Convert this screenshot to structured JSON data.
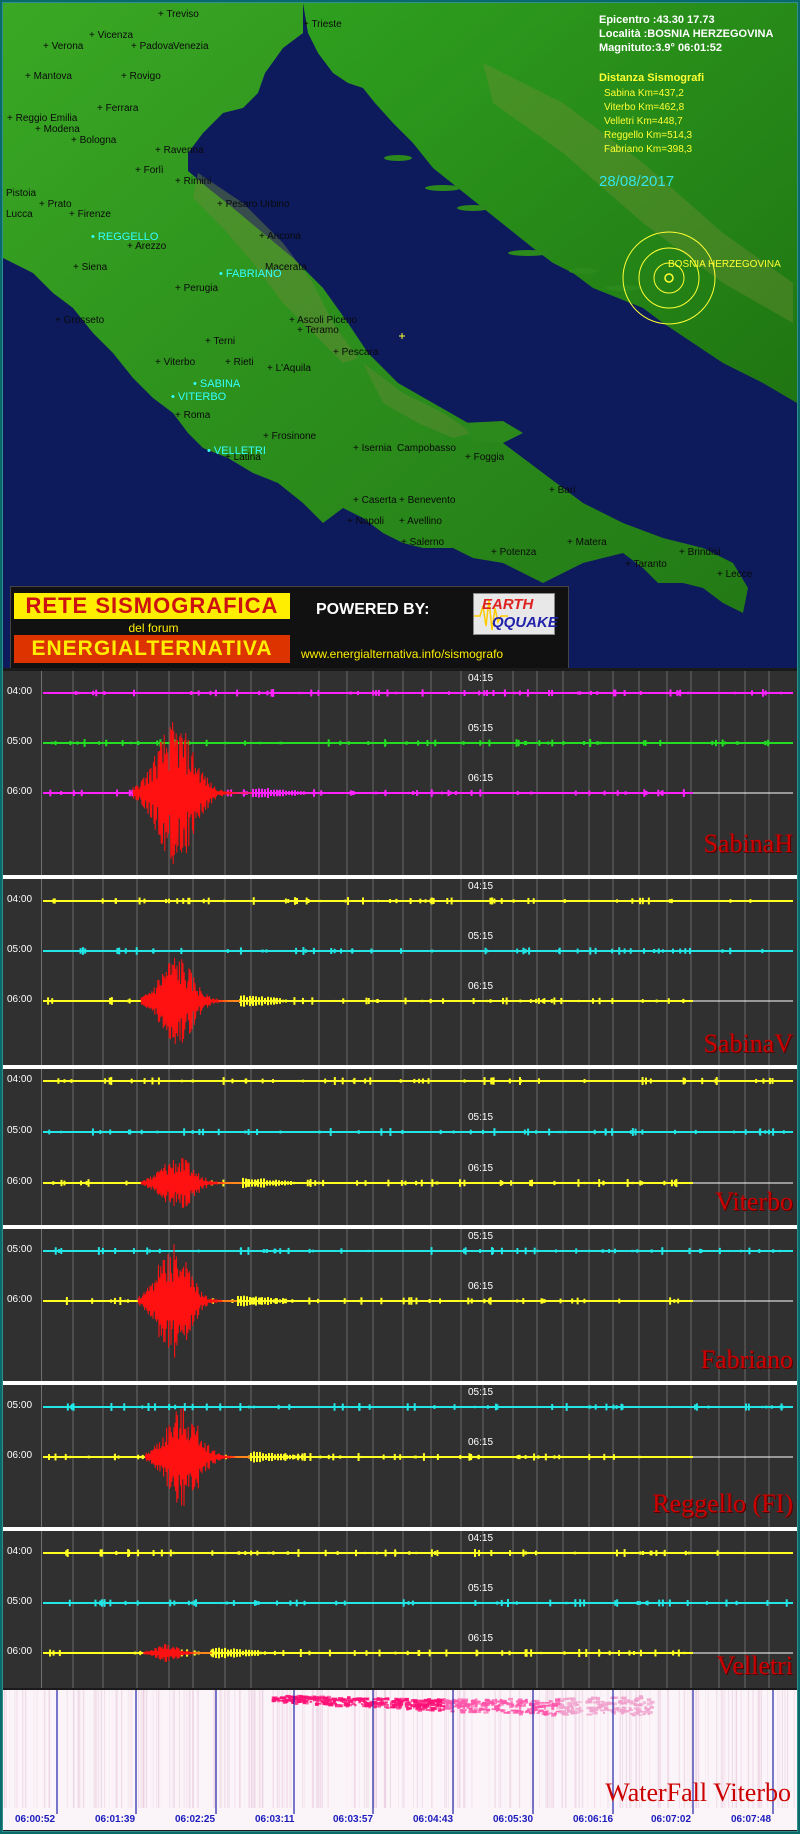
{
  "map": {
    "info": {
      "epicentro": "Epicentro :43.30 17.73",
      "localita": "Località :BOSNIA HERZEGOVINA",
      "magnitudo": "Magnituto:3.9°  06:01:52",
      "distanza_title": "Distanza Sismografi",
      "distances": [
        "Sabina Km=437,2",
        "Viterbo Km=462,8",
        "Velletri Km=448,7",
        "Reggello Km=514,3",
        "Fabriano Km=398,3"
      ],
      "date": "28/08/2017"
    },
    "epicenter_label": "BOSNIA HERZEGOVINA",
    "cities": [
      "Treviso",
      "Trieste",
      "Vicenza",
      "Verona",
      "Padova",
      "Venezia",
      "Mantova",
      "Rovigo",
      "Ferrara",
      "Reggio Emilia",
      "Modena",
      "Bologna",
      "Ravenna",
      "Forlì",
      "Rimini",
      "Pistoia",
      "Prato",
      "Firenze",
      "Lucca",
      "Pesaro Urbino",
      "Ancona",
      "Arezzo",
      "Siena",
      "Macerata",
      "Perugia",
      "Grosseto",
      "Ascoli Piceno",
      "Teramo",
      "Terni",
      "Pescara",
      "Viterbo",
      "Rieti",
      "L'Aquila",
      "Roma",
      "Frosinone",
      "Latina",
      "Isernia",
      "Campobasso",
      "Foggia",
      "Bari",
      "Caserta",
      "Benevento",
      "Napoli",
      "Avellino",
      "Salerno",
      "Potenza",
      "Matera",
      "Taranto",
      "Brindisi",
      "Lecce"
    ],
    "stations": [
      "REGGELLO",
      "FABRIANO",
      "SABINA",
      "VITERBO",
      "VELLETRI"
    ]
  },
  "banner": {
    "rete": "RETE SISMOGRAFICA",
    "forum": "del forum",
    "energia": "ENERGIALTERNATIVA",
    "powered": "POWERED BY:",
    "logo_earth": "EARTH",
    "logo_quake": "QQUAKE",
    "url": "www.energialternativa.info/sismografo"
  },
  "panels": [
    {
      "name": "SabinaH",
      "hours": [
        "04:00",
        "05:00",
        "06:00"
      ],
      "center": [
        "04:15",
        "05:15",
        "06:15"
      ]
    },
    {
      "name": "SabinaV",
      "hours": [
        "04:00",
        "05:00",
        "06:00"
      ],
      "center": [
        "04:15",
        "05:15",
        "06:15"
      ]
    },
    {
      "name": "Viterbo",
      "hours": [
        "04:00",
        "05:00",
        "06:00"
      ],
      "center": [
        "04:15",
        "05:15",
        "06:15"
      ]
    },
    {
      "name": "Fabriano",
      "hours": [
        "05:00",
        "06:00"
      ],
      "center": [
        "05:15",
        "06:15"
      ]
    },
    {
      "name": "Reggello (FI)",
      "hours": [
        "05:00",
        "06:00"
      ],
      "center": [
        "05:15",
        "06:15"
      ]
    },
    {
      "name": "Velletri",
      "hours": [
        "04:00",
        "05:00",
        "06:00"
      ],
      "center": [
        "04:15",
        "05:15",
        "06:15"
      ]
    }
  ],
  "waterfall": {
    "name": "WaterFall Viterbo",
    "ticks": [
      "06:00:52",
      "06:01:39",
      "06:02:25",
      "06:03:11",
      "06:03:57",
      "06:04:43",
      "06:05:30",
      "06:06:16",
      "06:07:02",
      "06:07:48"
    ]
  },
  "colors": {
    "sea": "#0d1a5c",
    "land": "#2e9a1e",
    "magenta": "#ff22ff",
    "green": "#22dd22",
    "yellow": "#ffff22",
    "cyan": "#22e6e6",
    "quake": "#ff1111",
    "panel_bg": "#303030"
  }
}
